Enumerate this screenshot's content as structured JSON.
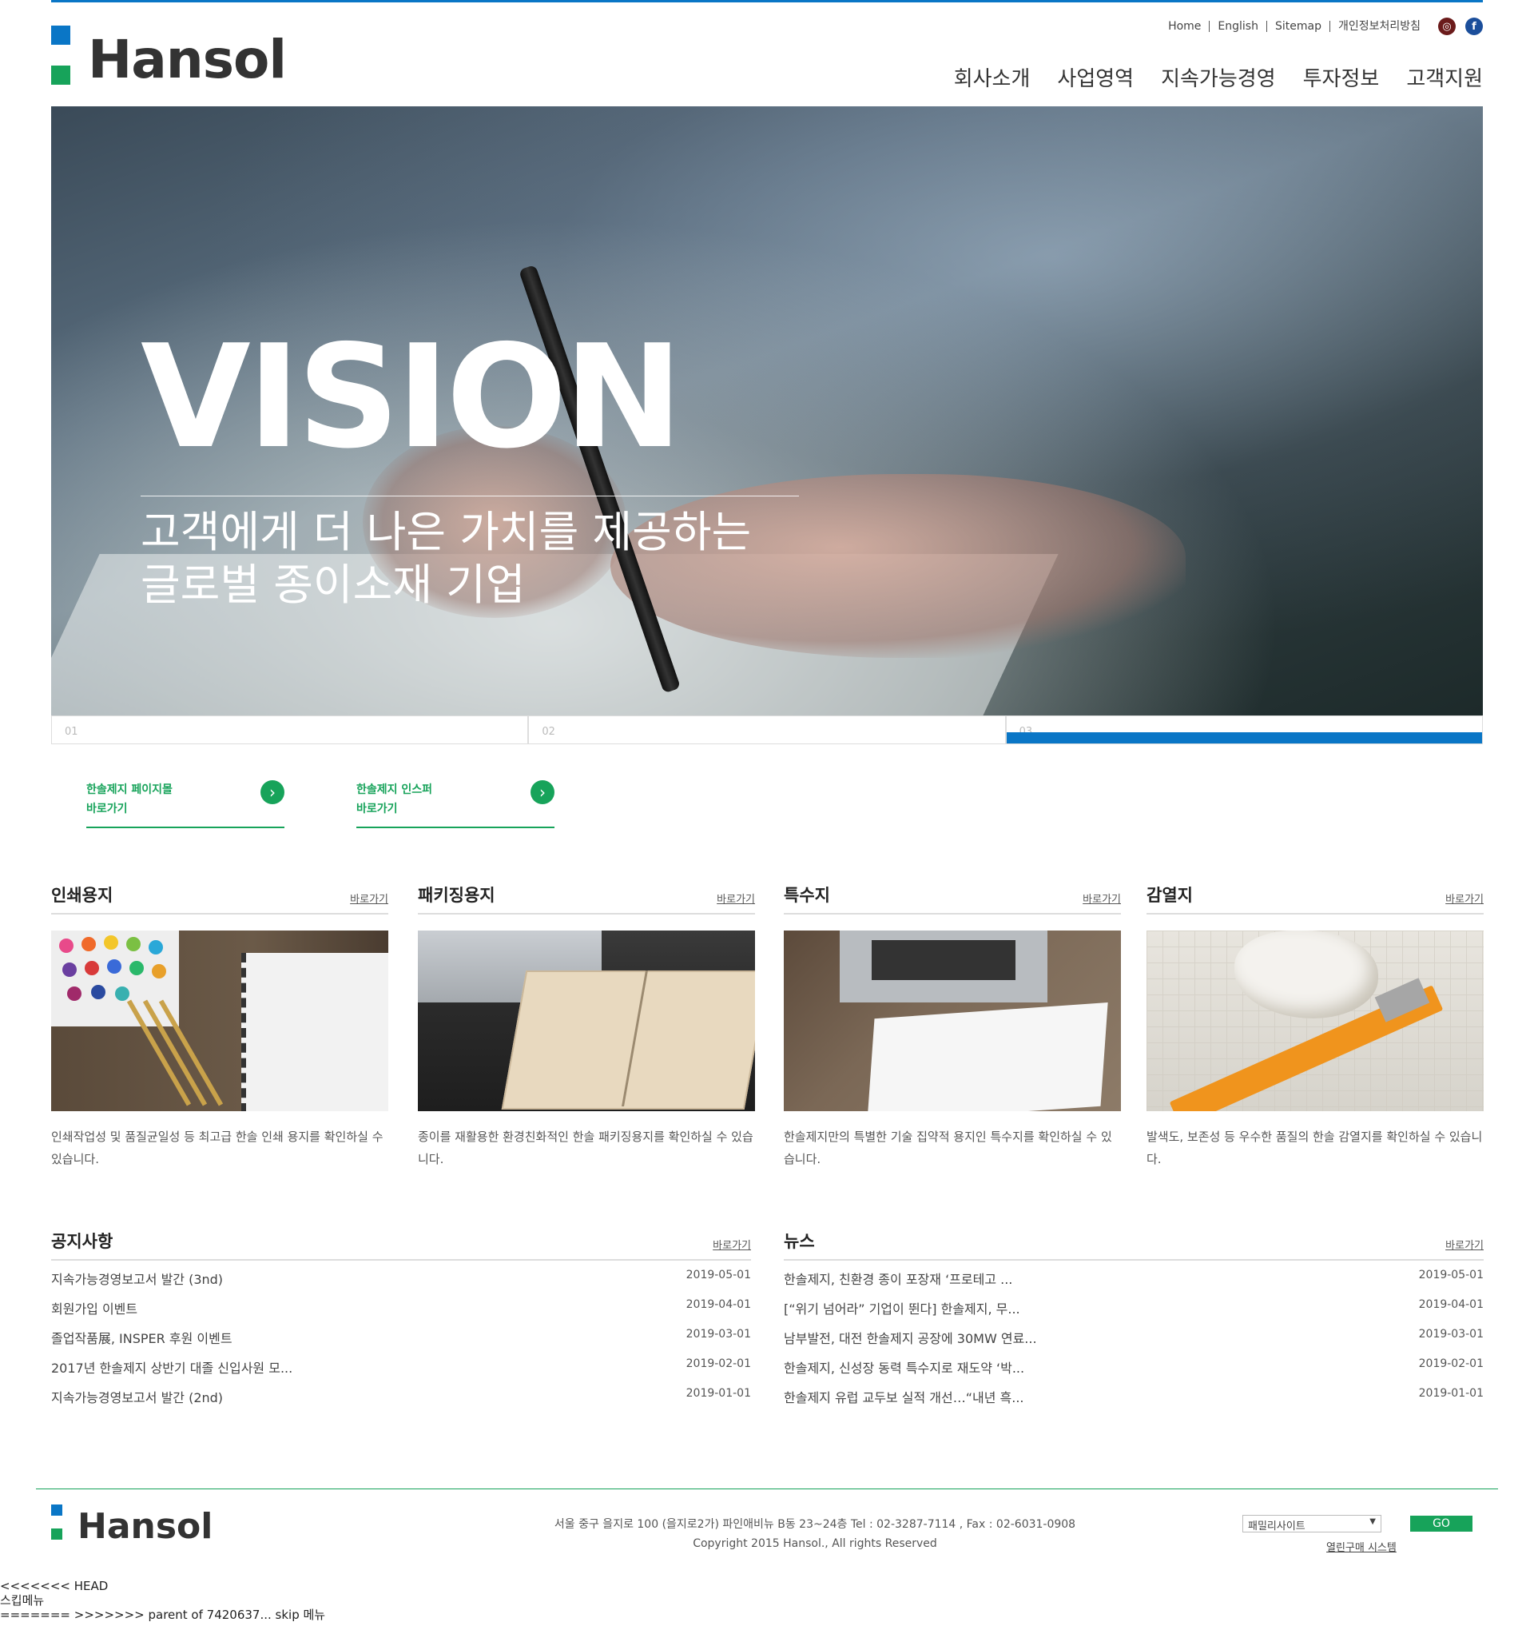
{
  "header": {
    "logo_text": "Hansol",
    "util_links": [
      "Home",
      "English",
      "Sitemap",
      "개인정보처리방침"
    ],
    "social_icons": [
      "instagram-icon",
      "facebook-icon"
    ],
    "nav": [
      "회사소개",
      "사업영역",
      "지속가능경영",
      "투자정보",
      "고객지원"
    ]
  },
  "hero": {
    "title": "VISION",
    "subtitle_line1": "고객에게 더 나은 가치를 제공하는",
    "subtitle_line2": "글로벌 종이소재 기업",
    "tabs": [
      "01",
      "02",
      "03"
    ],
    "active_tab": 3
  },
  "quick_links": [
    {
      "line1": "한솔제지 페이지몰",
      "line2": "바로가기"
    },
    {
      "line1": "한솔제지 인스퍼",
      "line2": "바로가기"
    }
  ],
  "products": [
    {
      "title": "인쇄용지",
      "more": "바로가기",
      "desc": "인쇄작업성 및 품질균일성 등 최고급 한솔 인쇄 용지를 확인하실 수 있습니다."
    },
    {
      "title": "패키징용지",
      "more": "바로가기",
      "desc": "종이를 재활용한 환경친화적인 한솔 패키징용지를 확인하실 수 있습니다."
    },
    {
      "title": "특수지",
      "more": "바로가기",
      "desc": "한솔제지만의 특별한 기술 집약적 용지인 특수지를 확인하실 수 있습니다."
    },
    {
      "title": "감열지",
      "more": "바로가기",
      "desc": "발색도, 보존성 등 우수한 품질의 한솔 감열지를 확인하실 수 있습니다."
    }
  ],
  "notice": {
    "title": "공지사항",
    "more": "바로가기",
    "items": [
      {
        "title": "지속가능경영보고서 발간 (3nd)",
        "date": "2019-05-01"
      },
      {
        "title": "회원가입 이벤트",
        "date": "2019-04-01"
      },
      {
        "title": "졸업작품展, INSPER 후원 이벤트",
        "date": "2019-03-01"
      },
      {
        "title": "2017년 한솔제지 상반기 대졸 신입사원 모...",
        "date": "2019-02-01"
      },
      {
        "title": "지속가능경영보고서 발간 (2nd)",
        "date": "2019-01-01"
      }
    ]
  },
  "news": {
    "title": "뉴스",
    "more": "바로가기",
    "items": [
      {
        "title": "한솔제지, 친환경 종이 포장재 ‘프로테고 ...",
        "date": "2019-05-01"
      },
      {
        "title": "[“위기 넘어라” 기업이 뛴다] 한솔제지, 무...",
        "date": "2019-04-01"
      },
      {
        "title": "남부발전, 대전 한솔제지 공장에 30MW 연료...",
        "date": "2019-03-01"
      },
      {
        "title": "한솔제지, 신성장 동력 특수지로 재도약 ‘박...",
        "date": "2019-02-01"
      },
      {
        "title": "한솔제지 유럽 교두보 실적 개선…“내년 흑...",
        "date": "2019-01-01"
      }
    ]
  },
  "footer": {
    "logo_text": "Hansol",
    "address": "서울 중구 을지로 100 (을지로2가) 파인애비뉴 B동 23~24층 Tel : 02-3287-7114 , Fax : 02-6031-0908",
    "copyright": "Copyright 2015 Hansol., All rights Reserved",
    "family_select": "패밀리사이트",
    "go_label": "GO",
    "purchase_link": "열린구매 시스템"
  },
  "debug_text": {
    "line1": "<<<<<<< HEAD",
    "line2": "스킵메뉴",
    "line3": "======= >>>>>>> parent of 7420637... skip 메뉴"
  },
  "colors": {
    "brand_blue": "#0a76c6",
    "brand_green": "#17a35a"
  }
}
